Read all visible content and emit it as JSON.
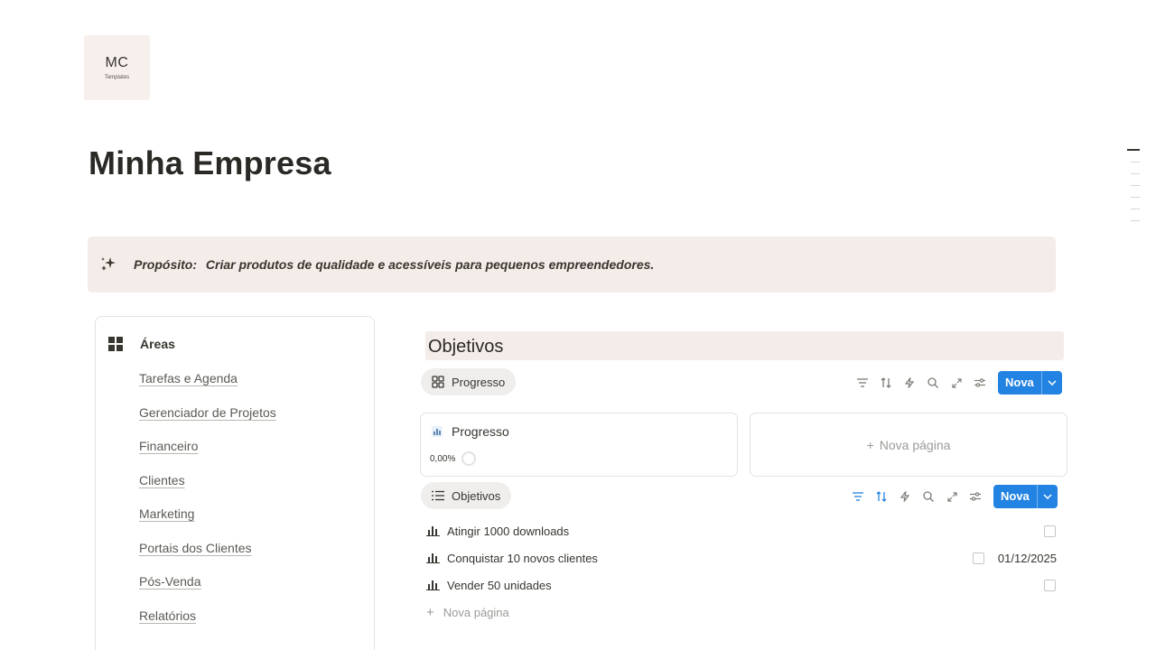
{
  "logo": {
    "main": "MC",
    "sub": "Templates"
  },
  "page_title": "Minha Empresa",
  "callout": {
    "icon": "sparkles-icon",
    "label": "Propósito:",
    "text": "Criar produtos de qualidade e acessíveis para pequenos empreendedores."
  },
  "areas": {
    "title": "Áreas",
    "icon": "grid-icon",
    "items": [
      "Tarefas e Agenda",
      "Gerenciador de Projetos",
      "Financeiro",
      "Clientes",
      "Marketing",
      "Portais dos Clientes",
      "Pós-Venda",
      "Relatórios"
    ]
  },
  "objetivos": {
    "heading": "Objetivos",
    "board_view": {
      "label": "Progresso",
      "icon": "gallery-icon"
    },
    "new_button": "Nova",
    "cards": [
      {
        "title": "Progresso",
        "icon": "chart-icon",
        "value": "0,00%"
      },
      {
        "new_label": "Nova página"
      }
    ],
    "list_view": {
      "label": "Objetivos",
      "icon": "list-icon"
    },
    "rows": [
      {
        "title": "Atingir 1000 downloads",
        "date": ""
      },
      {
        "title": "Conquistar 10 novos clientes",
        "date": "01/12/2025"
      },
      {
        "title": "Vender 50 unidades",
        "date": ""
      }
    ],
    "new_row": "Nova página"
  },
  "colors": {
    "accent": "#2383e2",
    "callout_bg": "#f4ece8",
    "text": "#37352f",
    "muted": "#9b9a97"
  }
}
